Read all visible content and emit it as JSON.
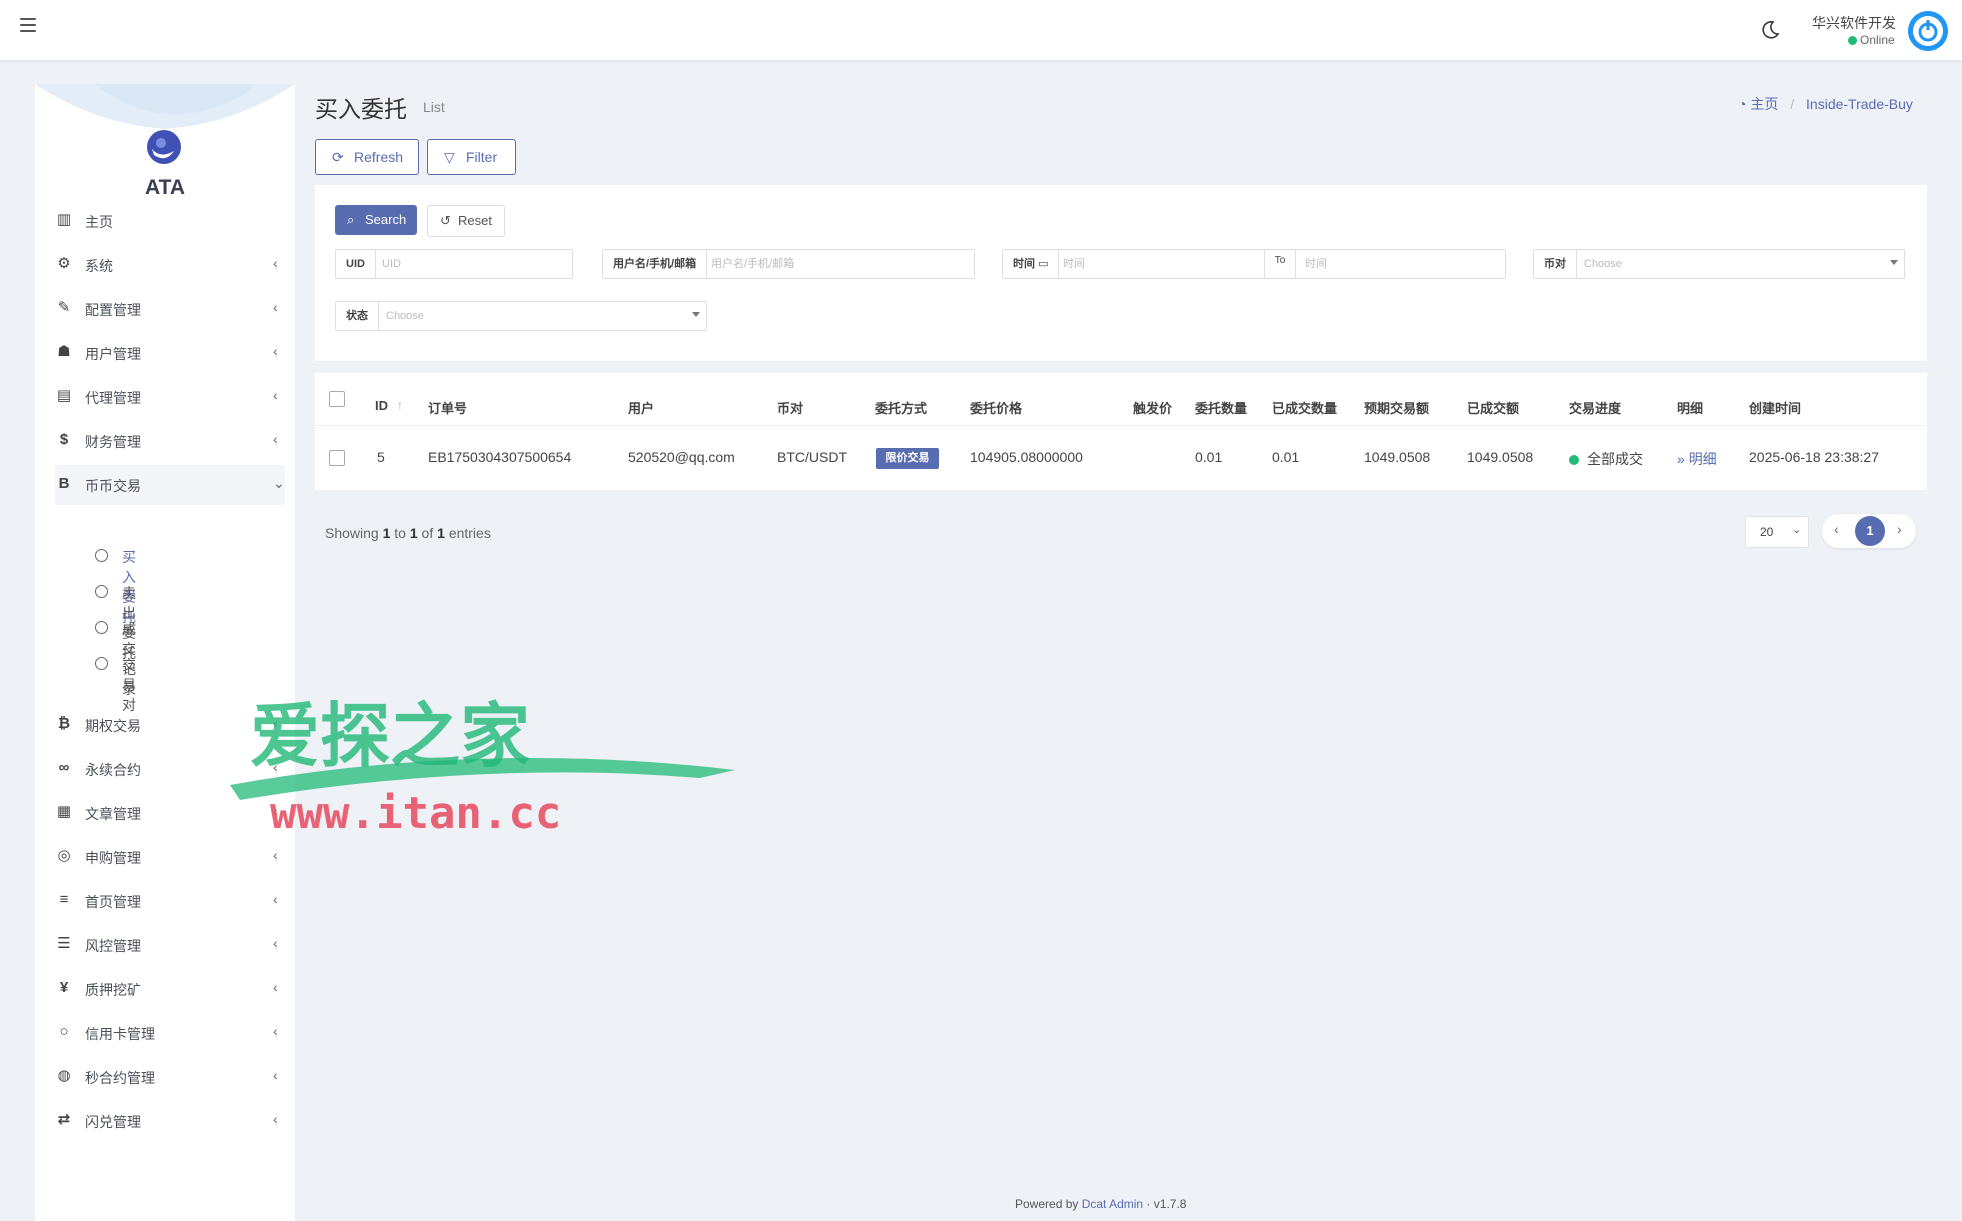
{
  "header": {
    "menu_icon": "hamburger-icon",
    "theme_icon": "moon-icon",
    "user_name": "华兴软件开发",
    "user_status": "Online",
    "avatar_icon": "power-icon"
  },
  "sidebar": {
    "brand": "ATA",
    "items": [
      {
        "label": "主页",
        "icon": "bar-chart-icon",
        "has_chevron": false
      },
      {
        "label": "系统",
        "icon": "gear-icon",
        "has_chevron": true
      },
      {
        "label": "配置管理",
        "icon": "wrench-icon",
        "has_chevron": true
      },
      {
        "label": "用户管理",
        "icon": "user-icon",
        "has_chevron": true
      },
      {
        "label": "代理管理",
        "icon": "id-card-icon",
        "has_chevron": true
      },
      {
        "label": "财务管理",
        "icon": "dollar-icon",
        "has_chevron": true
      },
      {
        "label": "币币交易",
        "icon": "bold-b-icon",
        "has_chevron": true,
        "expanded": true
      },
      {
        "label": "期权交易",
        "icon": "bitcoin-icon",
        "has_chevron": true
      },
      {
        "label": "永续合约",
        "icon": "link-icon",
        "has_chevron": true
      },
      {
        "label": "文章管理",
        "icon": "newspaper-icon",
        "has_chevron": true
      },
      {
        "label": "申购管理",
        "icon": "life-ring-icon",
        "has_chevron": true
      },
      {
        "label": "首页管理",
        "icon": "list-icon",
        "has_chevron": true
      },
      {
        "label": "风控管理",
        "icon": "indent-icon",
        "has_chevron": true
      },
      {
        "label": "质押挖矿",
        "icon": "yen-icon",
        "has_chevron": true
      },
      {
        "label": "信用卡管理",
        "icon": "circle-icon",
        "has_chevron": true
      },
      {
        "label": "秒合约管理",
        "icon": "fingerprint-icon",
        "has_chevron": true
      },
      {
        "label": "闪兑管理",
        "icon": "exchange-icon",
        "has_chevron": true
      }
    ],
    "sub_items": [
      {
        "label": "买入委托",
        "active": true
      },
      {
        "label": "卖出委托",
        "active": false
      },
      {
        "label": "成交记录",
        "active": false
      },
      {
        "label": "交易对",
        "active": false
      }
    ]
  },
  "page": {
    "title": "买入委托",
    "subtitle": "List",
    "breadcrumb_home": "主页",
    "breadcrumb_current": "Inside-Trade-Buy",
    "refresh_label": "Refresh",
    "filter_label": "Filter"
  },
  "filters": {
    "search_label": "Search",
    "reset_label": "Reset",
    "uid_label": "UID",
    "uid_placeholder": "UID",
    "user_label": "用户名/手机/邮箱",
    "user_placeholder": "用户名/手机/邮箱",
    "time_label": "时间",
    "time_placeholder": "时间",
    "to_label": "To",
    "time_to_placeholder": "时间",
    "pair_label": "币对",
    "pair_placeholder": "Choose",
    "status_label": "状态",
    "status_placeholder": "Choose"
  },
  "table": {
    "columns": [
      "ID",
      "订单号",
      "用户",
      "币对",
      "委托方式",
      "委托价格",
      "触发价",
      "委托数量",
      "已成交数量",
      "预期交易额",
      "已成交额",
      "交易进度",
      "明细",
      "创建时间"
    ],
    "rows": [
      {
        "id": "5",
        "order_no": "EB1750304307500654",
        "user": "520520@qq.com",
        "pair": "BTC/USDT",
        "type": "限价交易",
        "price": "104905.08000000",
        "trigger": "",
        "quantity": "0.01",
        "filled_quantity": "0.01",
        "expected_amount": "1049.0508",
        "filled_amount": "1049.0508",
        "progress": "全部成交",
        "detail": "明细",
        "created_at": "2025-06-18 23:38:27"
      }
    ]
  },
  "pagination": {
    "showing_prefix": "Showing",
    "from": "1",
    "to_word": "to",
    "to": "1",
    "of_word": "of",
    "total": "1",
    "entries_word": "entries",
    "per_page": "20",
    "current_page": "1"
  },
  "footer": {
    "powered_by": "Powered by",
    "link_text": "Dcat Admin",
    "separator": "·",
    "version": "v1.7.8"
  },
  "watermark": {
    "title": "爱探之家",
    "url": "www.itan.cc"
  },
  "colors": {
    "primary": "#586cb1",
    "success": "#21b978",
    "background": "#eef1f6"
  }
}
